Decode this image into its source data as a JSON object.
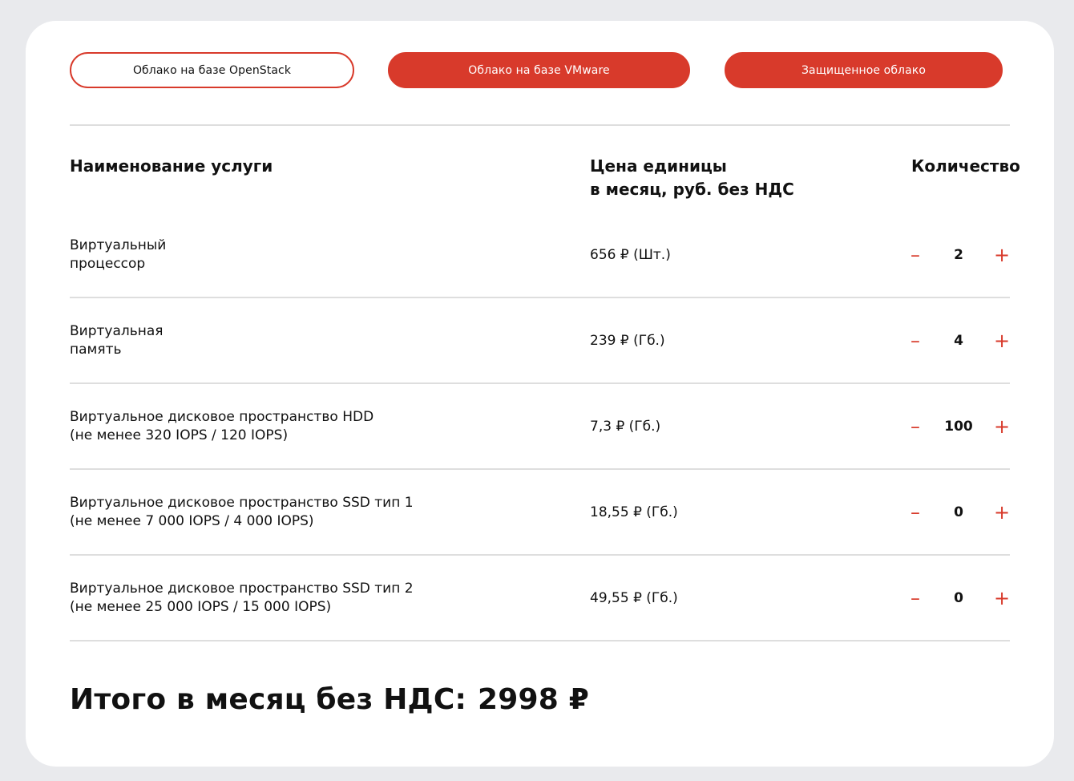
{
  "tabs": [
    {
      "label": "Облако на базе OpenStack",
      "style": "outline"
    },
    {
      "label": "Облако на базе VMware",
      "style": "filled"
    },
    {
      "label": "Защищенное облако",
      "style": "filled"
    }
  ],
  "colors": {
    "accent": "#d83a2b",
    "page_background": "#e9eaed",
    "card_background": "#ffffff",
    "divider": "#dedede"
  },
  "table": {
    "headers": {
      "name": "Наименование услуги",
      "price_line1": "Цена единицы",
      "price_line2": "в месяц, руб. без НДС",
      "quantity": "Количество"
    },
    "rows": [
      {
        "name_line1": "Виртуальный",
        "name_line2": "процессор",
        "price": "656 ₽ (Шт.)",
        "quantity": "2"
      },
      {
        "name_line1": "Виртуальная",
        "name_line2": "память",
        "price": "239 ₽ (Гб.)",
        "quantity": "4"
      },
      {
        "name_line1": "Виртуальное дисковое пространство HDD",
        "name_line2": "(не менее 320 IOPS / 120 IOPS)",
        "price": "7,3 ₽ (Гб.)",
        "quantity": "100"
      },
      {
        "name_line1": "Виртуальное дисковое пространство SSD тип 1",
        "name_line2": "(не менее 7 000 IOPS / 4 000 IOPS)",
        "price": "18,55 ₽ (Гб.)",
        "quantity": "0"
      },
      {
        "name_line1": "Виртуальное дисковое пространство SSD тип 2",
        "name_line2": "(не менее 25 000 IOPS / 15 000 IOPS)",
        "price": "49,55 ₽ (Гб.)",
        "quantity": "0"
      }
    ],
    "minus_symbol": "–",
    "plus_symbol": "+"
  },
  "total": {
    "label": "Итого в месяц без НДС:",
    "value": "2998 ₽"
  }
}
